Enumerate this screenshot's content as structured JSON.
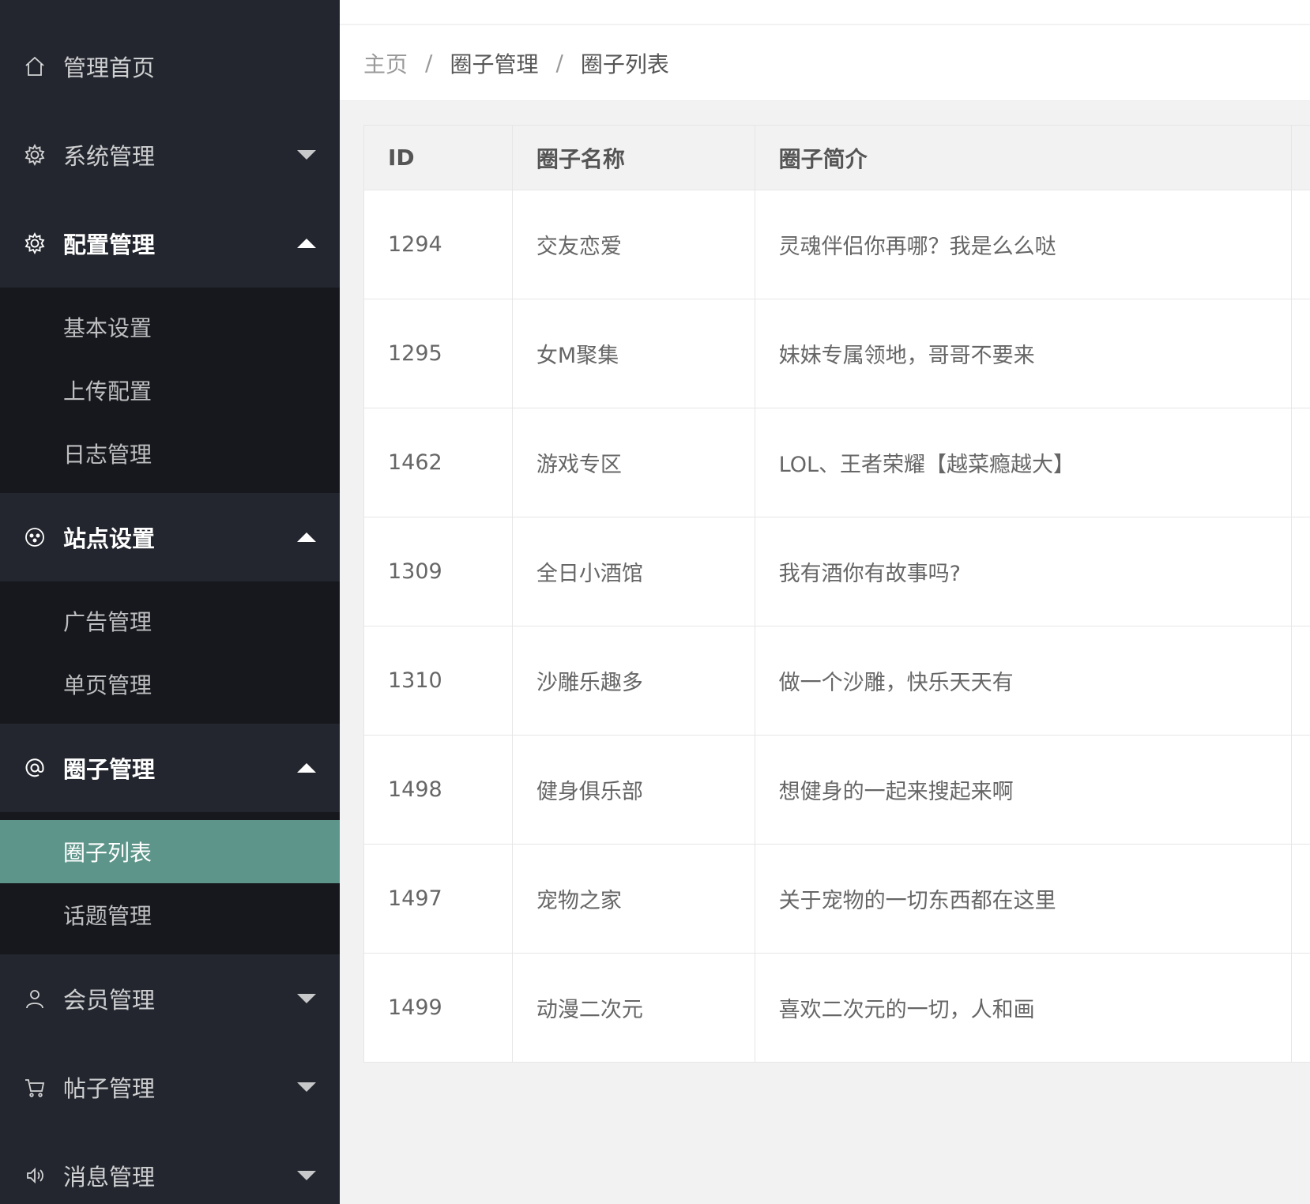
{
  "sidebar": {
    "items": [
      {
        "label": "管理首页",
        "icon": "home-icon"
      },
      {
        "label": "系统管理",
        "icon": "gear-icon",
        "expanded": false
      },
      {
        "label": "配置管理",
        "icon": "gear-icon",
        "expanded": true,
        "children": [
          "基本设置",
          "上传配置",
          "日志管理"
        ]
      },
      {
        "label": "站点设置",
        "icon": "compass-icon",
        "expanded": true,
        "children": [
          "广告管理",
          "单页管理"
        ]
      },
      {
        "label": "圈子管理",
        "icon": "at-icon",
        "expanded": true,
        "children": [
          "圈子列表",
          "话题管理"
        ],
        "active_child": "圈子列表"
      },
      {
        "label": "会员管理",
        "icon": "user-icon",
        "expanded": false
      },
      {
        "label": "帖子管理",
        "icon": "cart-icon",
        "expanded": false
      },
      {
        "label": "消息管理",
        "icon": "speaker-icon",
        "expanded": false
      }
    ]
  },
  "breadcrumb": {
    "items": [
      "主页",
      "圈子管理",
      "圈子列表"
    ],
    "separator": "/"
  },
  "table": {
    "headers": [
      "ID",
      "圈子名称",
      "圈子简介"
    ],
    "rows": [
      [
        "1294",
        "交友恋爱",
        "灵魂伴侣你再哪？我是么么哒"
      ],
      [
        "1295",
        "女M聚集",
        "妹妹专属领地，哥哥不要来"
      ],
      [
        "1462",
        "游戏专区",
        "LOL、王者荣耀【越菜瘾越大】"
      ],
      [
        "1309",
        "全日小酒馆",
        "我有酒你有故事吗?"
      ],
      [
        "1310",
        "沙雕乐趣多",
        "做一个沙雕，快乐天天有"
      ],
      [
        "1498",
        "健身俱乐部",
        "想健身的一起来搜起来啊"
      ],
      [
        "1497",
        "宠物之家",
        "关于宠物的一切东西都在这里"
      ],
      [
        "1499",
        "动漫二次元",
        "喜欢二次元的一切，人和画"
      ]
    ]
  },
  "colors": {
    "sidebar_bg": "#23262e",
    "submenu_bg": "#16181d",
    "active_item_bg": "#5d958a"
  }
}
